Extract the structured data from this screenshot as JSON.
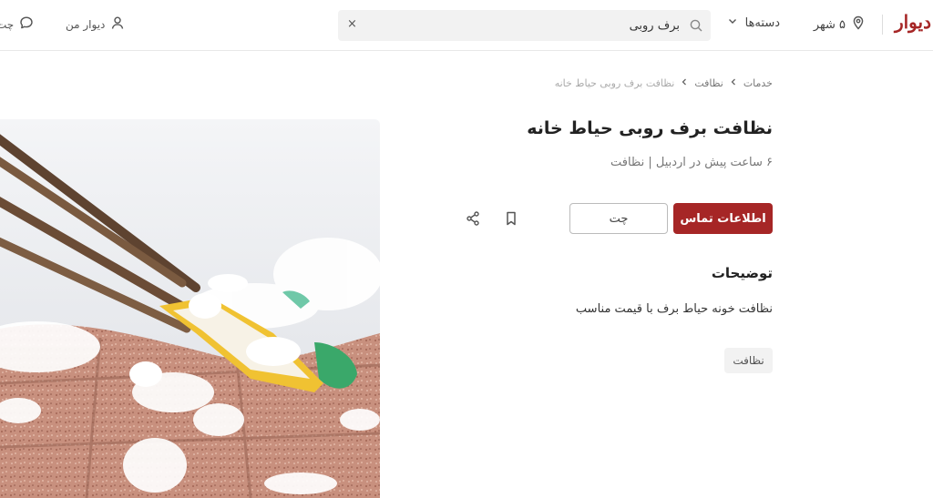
{
  "header": {
    "logo_text": "دیوار",
    "city_label": "۵ شهر",
    "categories_label": "دسته‌ها",
    "search_value": "برف روبی",
    "clear_symbol": "×",
    "my_divar_label": "دیوار من",
    "chat_label": "چت"
  },
  "breadcrumb": {
    "items": [
      "خدمات",
      "نظافت",
      "نظافت برف روبی حیاط خانه"
    ]
  },
  "ad": {
    "title": "نظافت برف روبی حیاط خانه",
    "subtitle": "۶ ساعت پیش در اردبیل | نظافت",
    "contact_button": "اطلاعات تماس",
    "chat_button": "چت",
    "description_heading": "توضیحات",
    "description_text": "نظافت خونه حیاط برف با قیمت مناسب",
    "tag": "نظافت"
  },
  "colors": {
    "brand": "#a62626",
    "border": "#e8e8e8"
  },
  "icons": [
    "location-pin-icon",
    "chevron-down-icon",
    "search-icon",
    "close-icon",
    "user-icon",
    "chat-bubble-icon",
    "chevron-left-icon",
    "bookmark-icon",
    "share-icon"
  ]
}
